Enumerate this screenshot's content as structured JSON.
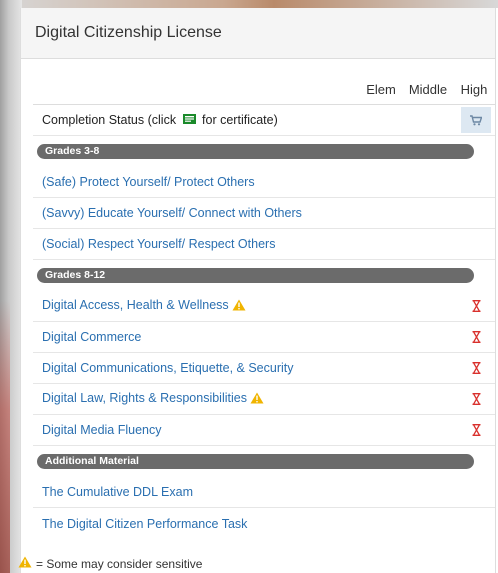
{
  "panel": {
    "title": "Digital Citizenship License"
  },
  "columns": {
    "elem": "Elem",
    "middle": "Middle",
    "high": "High"
  },
  "completion": {
    "prefix": "Completion Status (click",
    "suffix": "for certificate)"
  },
  "sections": {
    "grades_3_8": {
      "label": "Grades 3-8",
      "items": [
        "(Safe) Protect Yourself/ Protect Others",
        "(Savvy) Educate Yourself/ Connect with Others",
        "(Social) Respect Yourself/ Respect Others"
      ]
    },
    "grades_8_12": {
      "label": "Grades 8-12",
      "items": [
        "Digital Access, Health & Wellness",
        "Digital Commerce",
        "Digital Communications, Etiquette, & Security",
        "Digital Law, Rights & Responsibilities",
        "Digital Media Fluency"
      ]
    },
    "additional": {
      "label": "Additional Material",
      "items": [
        "The Cumulative DDL Exam",
        "The Digital Citizen Performance Task"
      ]
    }
  },
  "legend": {
    "text": "= Some may consider sensitive"
  },
  "icons": {
    "certificate": "certificate-icon",
    "cart": "cart-icon",
    "hourglass": "hourglass-icon",
    "warning": "warning-icon"
  },
  "colors": {
    "link": "#2a6fb0",
    "section_pill": "#6b6b6b",
    "hourglass": "#d9302c",
    "warning": "#f0b400",
    "cart_cell": "#dde8f2"
  }
}
